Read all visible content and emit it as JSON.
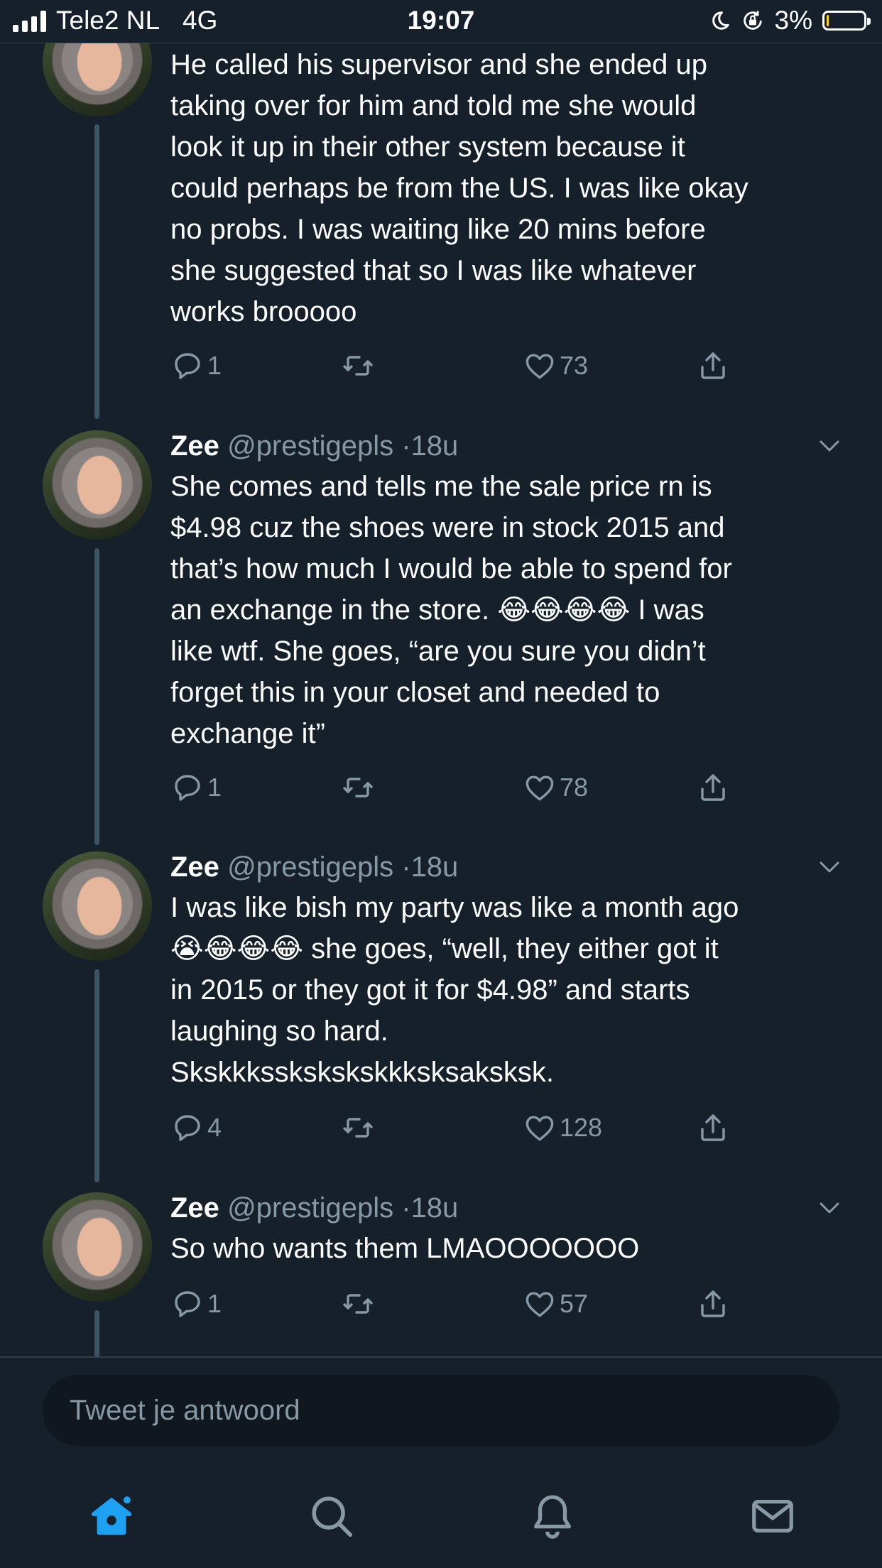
{
  "status_bar": {
    "carrier": "Tele2 NL",
    "network": "4G",
    "time": "19:07",
    "battery_percent_label": "3%",
    "battery_level": 0.03,
    "icons": [
      "signal-icon",
      "moon-icon",
      "rotation-lock-icon",
      "battery-icon"
    ]
  },
  "tweets": [
    {
      "text": "He called his supervisor and she ended up\ntaking over for him and told me she would\nlook it up in their other system because it\ncould perhaps be from the US. I was like okay\nno probs. I was waiting like 20 mins before\nshe suggested that so I was like whatever\nworks brooooo",
      "replies": "1",
      "likes": "73"
    },
    {
      "name": "Zee",
      "handle": "@prestigepls",
      "dot": "·",
      "time": "18u",
      "text": "She comes and tells me the sale price rn is\n$4.98 cuz the shoes were in stock 2015 and\nthat’s how much I would be able to spend for\nan exchange in the store. 😂😂😂😂 I was\nlike wtf. She goes, “are you sure you didn’t\nforget this in your closet and needed to\nexchange it”",
      "replies": "1",
      "likes": "78"
    },
    {
      "name": "Zee",
      "handle": "@prestigepls",
      "dot": "·",
      "time": "18u",
      "text": "I was like bish my party was like a month ago\n😭😂😂😂 she goes, “well, they either got it\nin 2015 or they got it for $4.98” and starts\nlaughing so hard.\nSkskkksskskskskkksksaksksk.",
      "replies": "4",
      "likes": "128"
    },
    {
      "name": "Zee",
      "handle": "@prestigepls",
      "dot": "·",
      "time": "18u",
      "text": "So who wants them LMAOOOOOOO",
      "replies": "1",
      "likes": "57"
    }
  ],
  "reply": {
    "placeholder": "Tweet je antwoord"
  },
  "tab_bar": {
    "tabs": [
      "home-icon",
      "search-icon",
      "notifications-icon",
      "messages-icon"
    ],
    "active": "home-icon",
    "accent": "#1da1f2"
  },
  "colors": {
    "background": "#15202b",
    "secondary_text": "#8899a6",
    "accent": "#1da1f2",
    "thread_line": "#3d5466"
  }
}
